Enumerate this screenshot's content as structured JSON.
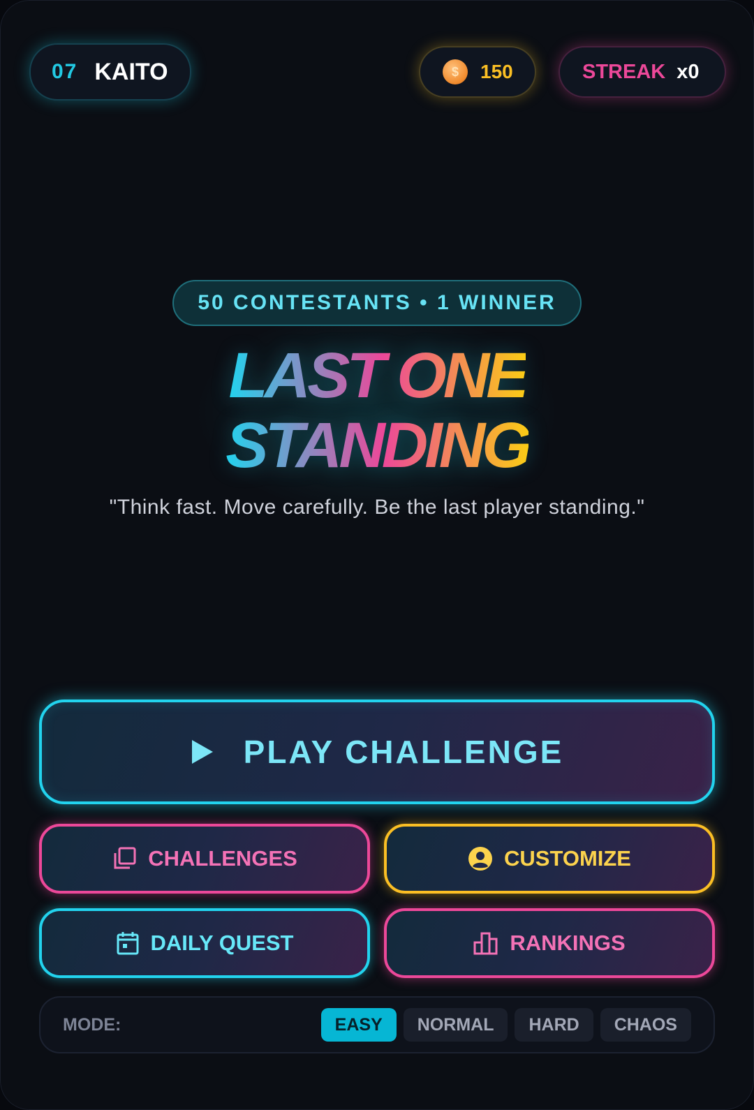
{
  "player": {
    "number": "07",
    "name": "KAITO"
  },
  "coins": {
    "value": "150",
    "icon": "coin-icon"
  },
  "streak": {
    "label": "STREAK",
    "value": "x0"
  },
  "hero": {
    "badge": "50 CONTESTANTS • 1 WINNER",
    "title_line1": "LAST ONE",
    "title_line2": "STANDING",
    "tagline": "\"Think fast. Move carefully. Be the last player standing.\""
  },
  "buttons": {
    "play": "PLAY CHALLENGE",
    "challenges": "CHALLENGES",
    "customize": "CUSTOMIZE",
    "daily_quest": "DAILY QUEST",
    "rankings": "RANKINGS"
  },
  "mode": {
    "label": "MODE:",
    "options": [
      "EASY",
      "NORMAL",
      "HARD",
      "CHAOS"
    ],
    "selected": "EASY"
  },
  "colors": {
    "cyan": "#22d3ee",
    "pink": "#ec4899",
    "yellow": "#fbbf24",
    "background": "#0b0e14"
  }
}
